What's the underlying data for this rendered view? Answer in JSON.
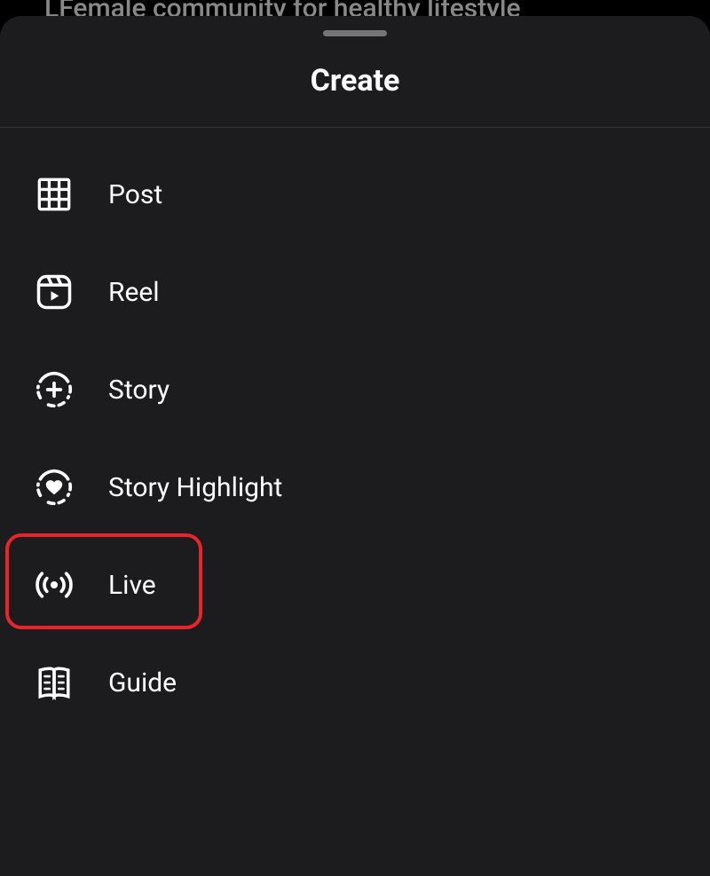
{
  "background": {
    "partial_text": "LFemale community for healthy lifestyle"
  },
  "sheet": {
    "title": "Create",
    "items": [
      {
        "icon": "grid-icon",
        "label": "Post"
      },
      {
        "icon": "reel-icon",
        "label": "Reel"
      },
      {
        "icon": "plus-dashed-icon",
        "label": "Story"
      },
      {
        "icon": "heart-dashed-icon",
        "label": "Story Highlight"
      },
      {
        "icon": "broadcast-icon",
        "label": "Live"
      },
      {
        "icon": "book-icon",
        "label": "Guide"
      }
    ]
  },
  "highlight": {
    "target_index": 4
  }
}
